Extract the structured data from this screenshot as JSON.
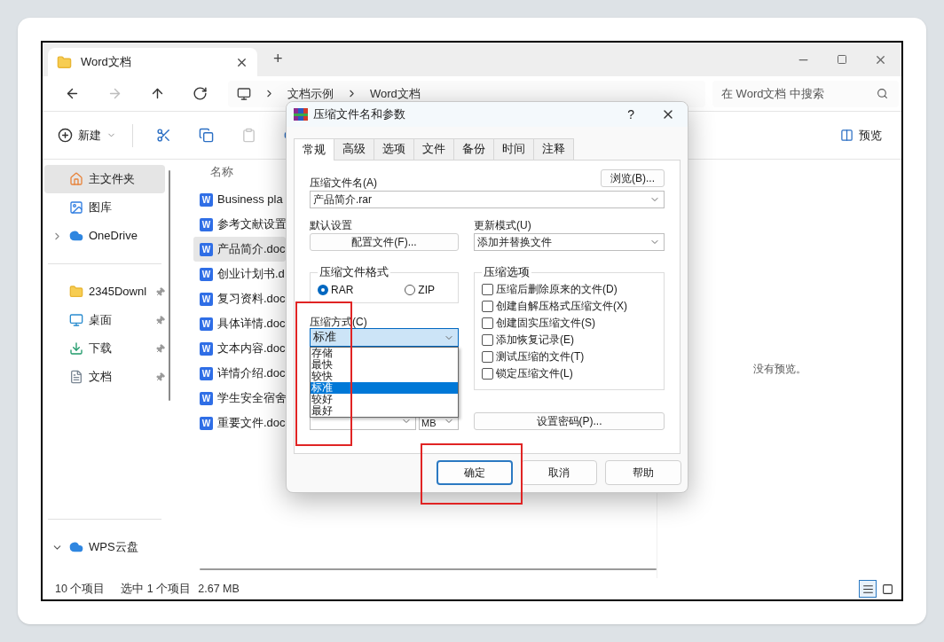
{
  "explorer": {
    "tab": {
      "title": "Word文档",
      "selected": true
    },
    "new_tab": "+",
    "nav_buttons": [
      {
        "kind": "back",
        "disabled": false
      },
      {
        "kind": "forward",
        "disabled": true
      },
      {
        "kind": "up",
        "disabled": false
      },
      {
        "kind": "refresh",
        "disabled": false
      }
    ],
    "breadcrumb": [
      "文档示例",
      "Word文档"
    ],
    "search": {
      "placeholder": "在 Word文档 中搜索"
    },
    "toolbar": [
      {
        "kind": "new",
        "label": "新建",
        "disabled": false
      },
      {
        "kind": "cut",
        "disabled": false
      },
      {
        "kind": "copy",
        "disabled": false
      },
      {
        "kind": "paste",
        "disabled": true
      },
      {
        "kind": "rename"
      }
    ],
    "preview_toggle": "预览",
    "sidebar": [
      [
        {
          "kind": "home",
          "label": "主文件夹",
          "selected": true
        },
        {
          "kind": "gallery",
          "label": "图库",
          "selected": false
        },
        {
          "kind": "cloud",
          "label": "OneDrive",
          "selected": false,
          "expanded": false
        }
      ],
      [
        {
          "kind": "folder",
          "label": "2345Downl",
          "selected": false,
          "pinned": true
        },
        {
          "kind": "desktop",
          "label": "桌面",
          "selected": false,
          "pinned": true
        },
        {
          "kind": "download",
          "label": "下载",
          "selected": false,
          "pinned": true
        },
        {
          "kind": "document",
          "label": "文档",
          "selected": false,
          "pinned": true
        }
      ],
      [
        {
          "kind": "cloud",
          "label": "WPS云盘",
          "selected": false,
          "expanded": true
        }
      ]
    ],
    "column_header": "名称",
    "files": [
      {
        "badge": "W",
        "name": "Business pla",
        "selected": false
      },
      {
        "badge": "W",
        "name": "参考文献设置",
        "selected": false
      },
      {
        "badge": "W",
        "name": "产品简介.doc",
        "selected": true
      },
      {
        "badge": "W",
        "name": "创业计划书.d",
        "selected": false
      },
      {
        "badge": "W",
        "name": "复习资料.doc",
        "selected": false
      },
      {
        "badge": "W",
        "name": "具体详情.doc",
        "selected": false
      },
      {
        "badge": "W",
        "name": "文本内容.doc",
        "selected": false
      },
      {
        "badge": "W",
        "name": "详情介绍.doc",
        "selected": false
      },
      {
        "badge": "W",
        "name": "学生安全宿舍",
        "selected": false
      },
      {
        "badge": "W",
        "name": "重要文件.doc",
        "selected": false
      }
    ],
    "preview_message": "没有预览。",
    "status": {
      "count": "10 个项目",
      "selection": "选中 1 个项目",
      "size": "2.67 MB"
    },
    "views": [
      {
        "kind": "details",
        "selected": true
      },
      {
        "kind": "tiles",
        "selected": false
      }
    ]
  },
  "dialog": {
    "title": "压缩文件名和参数",
    "help": "?",
    "tabs": [
      {
        "label": "常规",
        "selected": true
      },
      {
        "label": "高级",
        "selected": false
      },
      {
        "label": "选项",
        "selected": false
      },
      {
        "label": "文件",
        "selected": false
      },
      {
        "label": "备份",
        "selected": false
      },
      {
        "label": "时间",
        "selected": false
      },
      {
        "label": "注释",
        "selected": false
      }
    ],
    "archive_name": {
      "label": "压缩文件名(A)",
      "value": "产品简介.rar"
    },
    "browse_button": "浏览(B)...",
    "default_settings": {
      "label": "默认设置",
      "button": "配置文件(F)..."
    },
    "update_mode": {
      "label": "更新模式(U)",
      "value": "添加并替换文件"
    },
    "format": {
      "label": "压缩文件格式",
      "options": [
        {
          "label": "RAR",
          "selected": true
        },
        {
          "label": "ZIP",
          "selected": false
        }
      ]
    },
    "method": {
      "label": "压缩方式(C)",
      "value": "标准",
      "expanded": true,
      "options": [
        {
          "label": "存储",
          "selected": false
        },
        {
          "label": "最快",
          "selected": false
        },
        {
          "label": "较快",
          "selected": false
        },
        {
          "label": "标准",
          "selected": true
        },
        {
          "label": "较好",
          "selected": false
        },
        {
          "label": "最好",
          "selected": false
        }
      ]
    },
    "volume_unit": "MB",
    "options": {
      "label": "压缩选项",
      "items": [
        {
          "label": "压缩后删除原来的文件(D)",
          "checked": false
        },
        {
          "label": "创建自解压格式压缩文件(X)",
          "checked": false
        },
        {
          "label": "创建固实压缩文件(S)",
          "checked": false
        },
        {
          "label": "添加恢复记录(E)",
          "checked": false
        },
        {
          "label": "测试压缩的文件(T)",
          "checked": false
        },
        {
          "label": "锁定压缩文件(L)",
          "checked": false
        }
      ]
    },
    "password_button": "设置密码(P)...",
    "buttons": [
      {
        "label": "确定",
        "default": true
      },
      {
        "label": "取消",
        "default": false
      },
      {
        "label": "帮助",
        "default": false
      }
    ]
  }
}
